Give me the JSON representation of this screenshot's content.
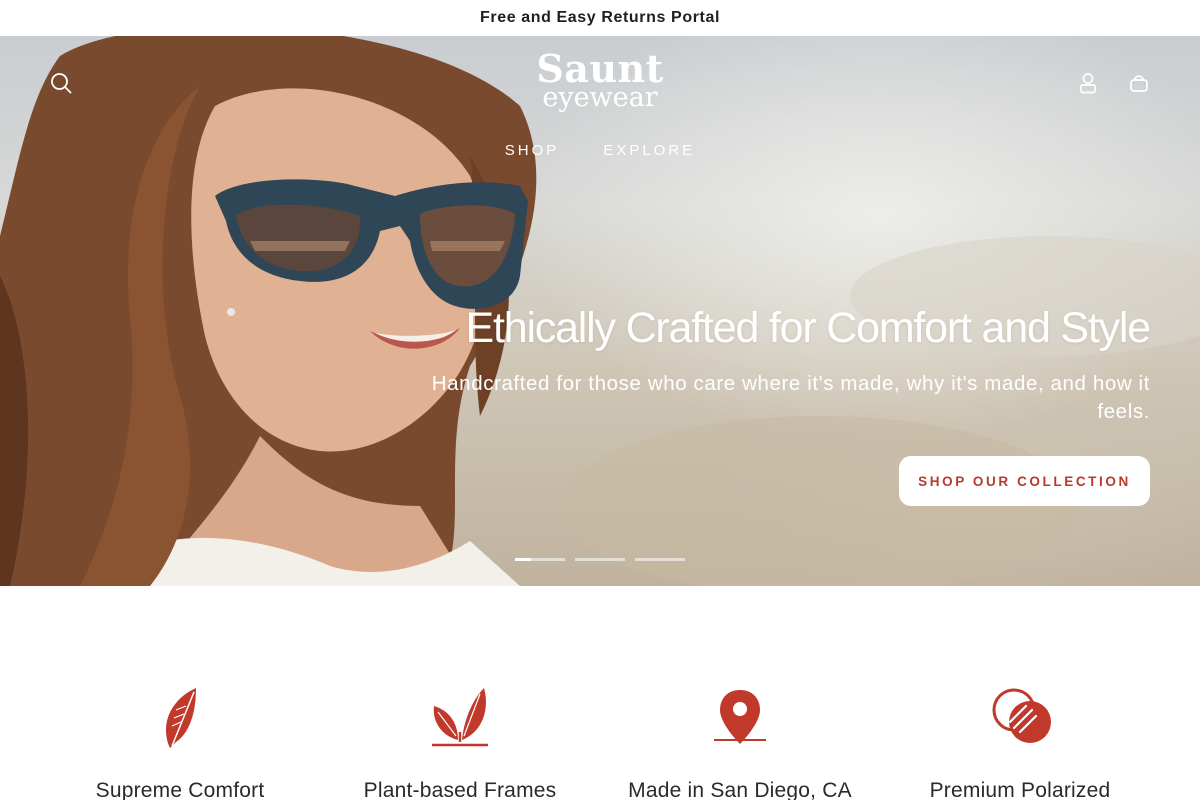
{
  "announcement": {
    "text": "Free and Easy Returns Portal"
  },
  "header": {
    "logo_line1": "Saunt",
    "logo_line2": "eyewear",
    "nav": [
      {
        "label": "SHOP"
      },
      {
        "label": "EXPLORE"
      }
    ]
  },
  "hero": {
    "title": "Ethically Crafted for Comfort and Style",
    "subtitle": "Handcrafted for those who care where it's made, why it's made, and how it feels.",
    "cta_label": "SHOP OUR COLLECTION",
    "slides_count": 3,
    "active_slide": 1
  },
  "features": [
    {
      "label": "Supreme Comfort",
      "icon": "feather-icon"
    },
    {
      "label": "Plant-based Frames",
      "icon": "leaves-icon"
    },
    {
      "label": "Made in San Diego, CA",
      "icon": "location-pin-icon"
    },
    {
      "label": "Premium Polarized",
      "icon": "polarized-lens-icon"
    }
  ],
  "colors": {
    "accent": "#c0392b",
    "button_text": "#b83a2f",
    "hero_text": "#ffffff"
  }
}
